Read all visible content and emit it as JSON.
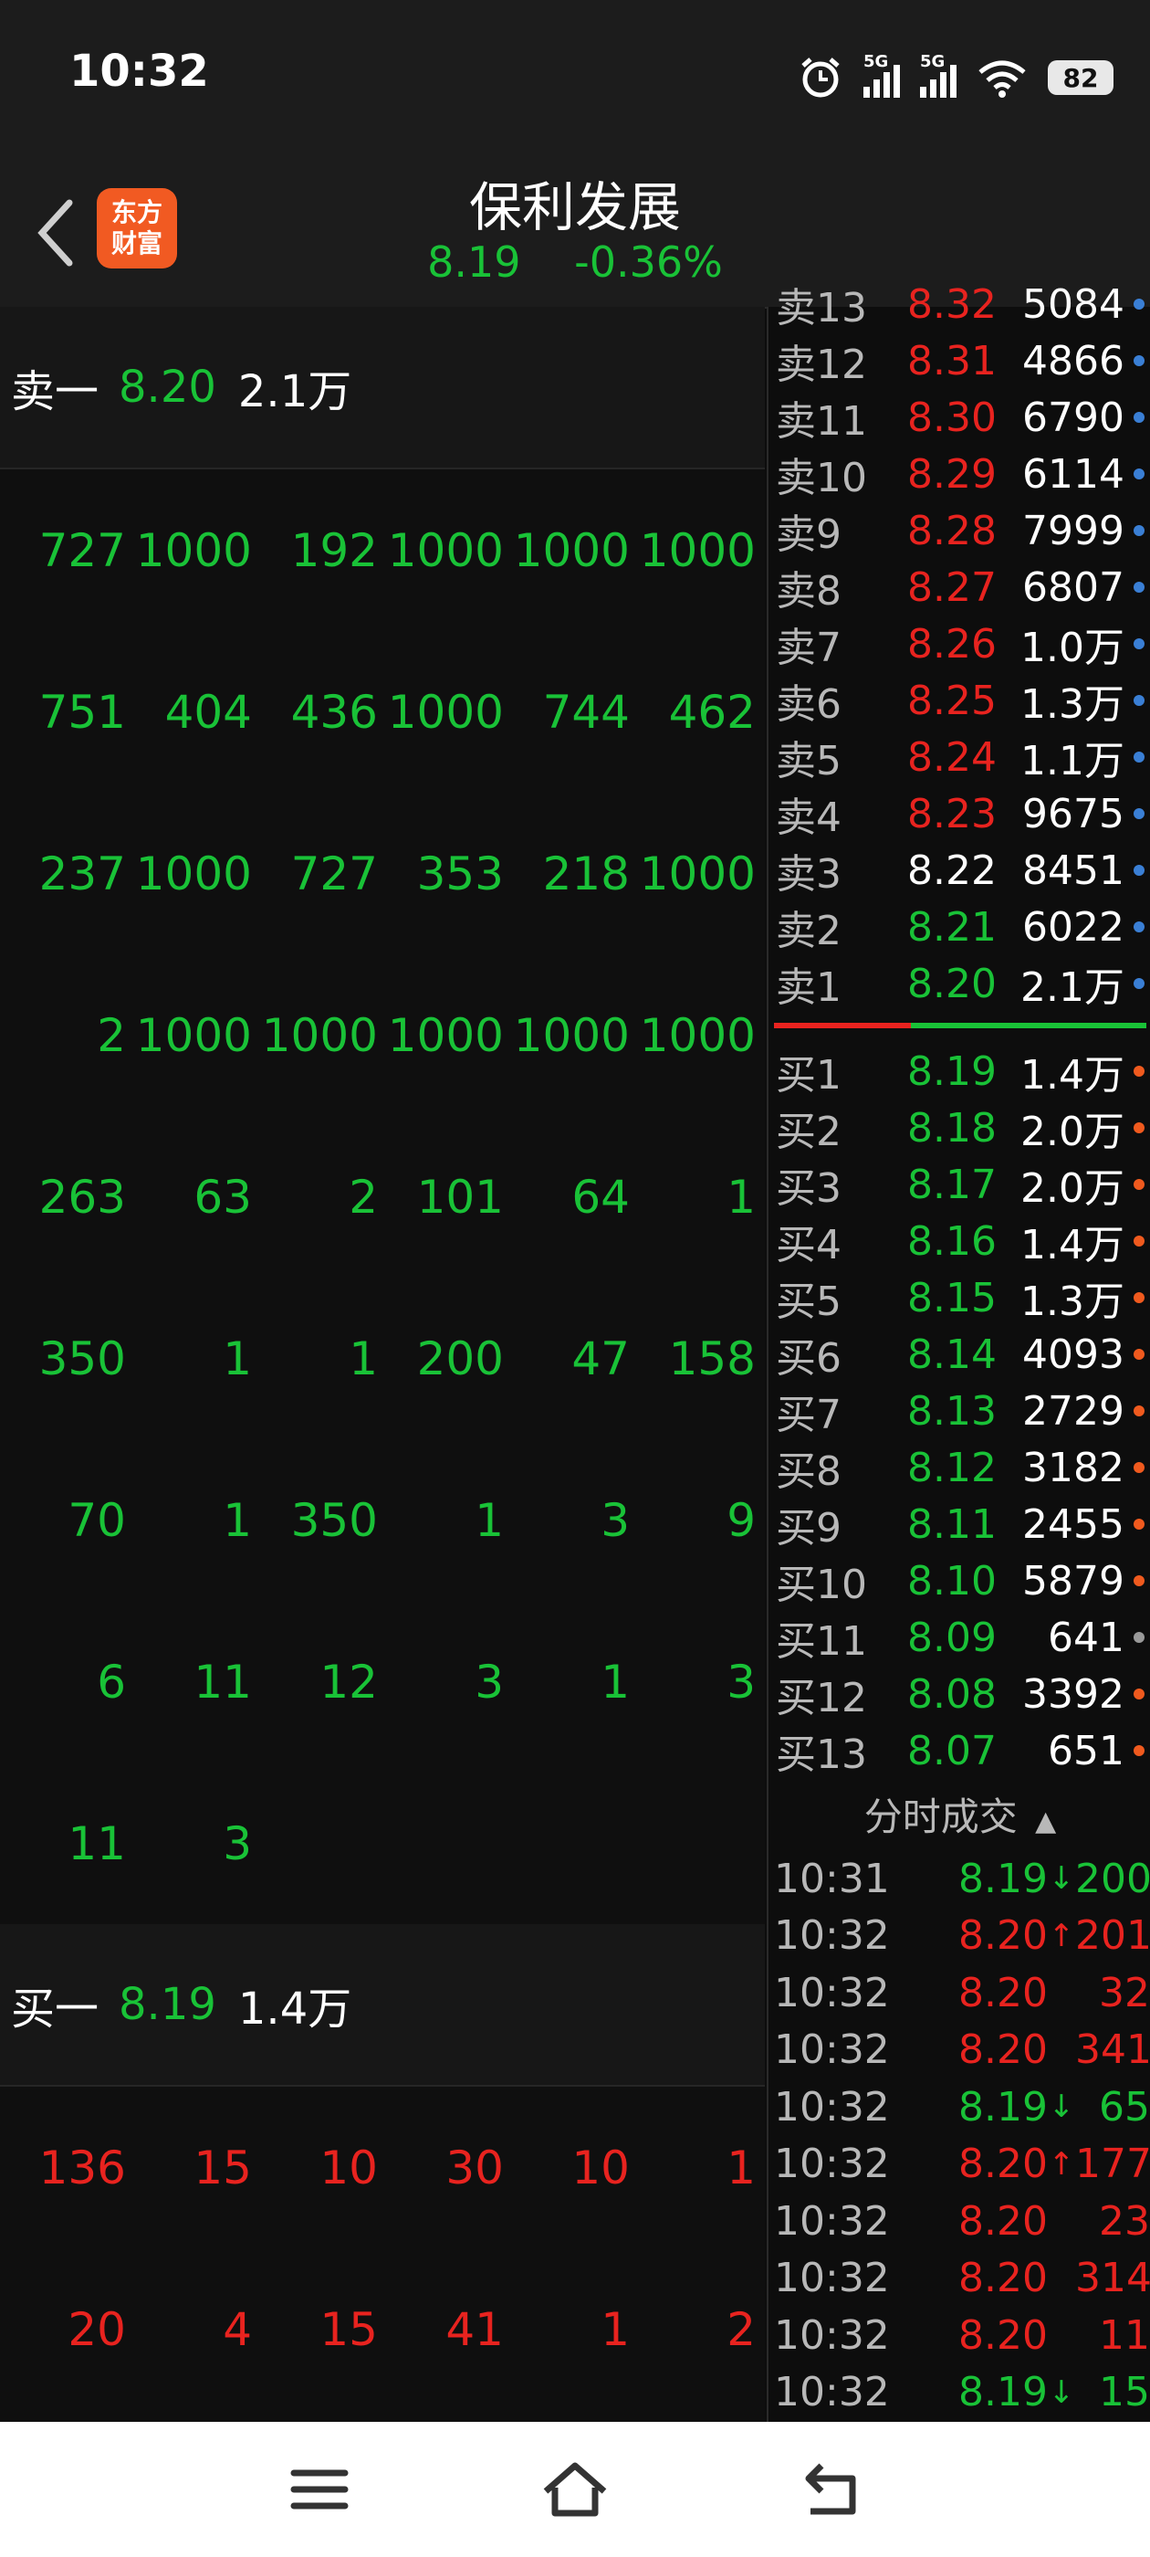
{
  "status_bar": {
    "time": "10:32",
    "network_1": "5G",
    "network_2": "5G",
    "battery": "82"
  },
  "header": {
    "logo_line1": "东方",
    "logo_line2": "财富",
    "title": "保利发展",
    "price": "8.19",
    "change": "-0.36%"
  },
  "left_panel": {
    "sell1": {
      "label": "卖一",
      "price": "8.20",
      "volume": "2.1万"
    },
    "sell_queue": [
      [
        "727",
        "1000",
        "192",
        "1000",
        "1000",
        "1000"
      ],
      [
        "751",
        "404",
        "436",
        "1000",
        "744",
        "462"
      ],
      [
        "237",
        "1000",
        "727",
        "353",
        "218",
        "1000"
      ],
      [
        "2",
        "1000",
        "1000",
        "1000",
        "1000",
        "1000"
      ],
      [
        "263",
        "63",
        "2",
        "101",
        "64",
        "1"
      ],
      [
        "350",
        "1",
        "1",
        "200",
        "47",
        "158"
      ],
      [
        "70",
        "1",
        "350",
        "1",
        "3",
        "9"
      ],
      [
        "6",
        "11",
        "12",
        "3",
        "1",
        "3"
      ],
      [
        "11",
        "3",
        "",
        "",
        "",
        ""
      ]
    ],
    "buy1": {
      "label": "买一",
      "price": "8.19",
      "volume": "1.4万"
    },
    "buy_queue": [
      [
        "136",
        "15",
        "10",
        "30",
        "10",
        "1"
      ],
      [
        "20",
        "4",
        "15",
        "41",
        "1",
        "2"
      ]
    ]
  },
  "order_book": {
    "partial_top": {
      "label": "卖13",
      "price": "8.32",
      "volume": "5084"
    },
    "asks": [
      {
        "label": "卖12",
        "price": "8.31",
        "volume": "4866",
        "color": "red",
        "dot": "blue"
      },
      {
        "label": "卖11",
        "price": "8.30",
        "volume": "6790",
        "color": "red",
        "dot": "blue"
      },
      {
        "label": "卖10",
        "price": "8.29",
        "volume": "6114",
        "color": "red",
        "dot": "blue"
      },
      {
        "label": "卖9",
        "price": "8.28",
        "volume": "7999",
        "color": "red",
        "dot": "blue"
      },
      {
        "label": "卖8",
        "price": "8.27",
        "volume": "6807",
        "color": "red",
        "dot": "blue"
      },
      {
        "label": "卖7",
        "price": "8.26",
        "volume": "1.0万",
        "color": "red",
        "dot": "blue"
      },
      {
        "label": "卖6",
        "price": "8.25",
        "volume": "1.3万",
        "color": "red",
        "dot": "blue"
      },
      {
        "label": "卖5",
        "price": "8.24",
        "volume": "1.1万",
        "color": "red",
        "dot": "blue"
      },
      {
        "label": "卖4",
        "price": "8.23",
        "volume": "9675",
        "color": "red",
        "dot": "blue"
      },
      {
        "label": "卖3",
        "price": "8.22",
        "volume": "8451",
        "color": "white",
        "dot": "blue"
      },
      {
        "label": "卖2",
        "price": "8.21",
        "volume": "6022",
        "color": "green",
        "dot": "blue"
      },
      {
        "label": "卖1",
        "price": "8.20",
        "volume": "2.1万",
        "color": "green",
        "dot": "blue"
      }
    ],
    "bids": [
      {
        "label": "买1",
        "price": "8.19",
        "volume": "1.4万",
        "color": "green",
        "dot": "orange"
      },
      {
        "label": "买2",
        "price": "8.18",
        "volume": "2.0万",
        "color": "green",
        "dot": "orange"
      },
      {
        "label": "买3",
        "price": "8.17",
        "volume": "2.0万",
        "color": "green",
        "dot": "orange"
      },
      {
        "label": "买4",
        "price": "8.16",
        "volume": "1.4万",
        "color": "green",
        "dot": "orange"
      },
      {
        "label": "买5",
        "price": "8.15",
        "volume": "1.3万",
        "color": "green",
        "dot": "orange"
      },
      {
        "label": "买6",
        "price": "8.14",
        "volume": "4093",
        "color": "green",
        "dot": "orange"
      },
      {
        "label": "买7",
        "price": "8.13",
        "volume": "2729",
        "color": "green",
        "dot": "orange"
      },
      {
        "label": "买8",
        "price": "8.12",
        "volume": "3182",
        "color": "green",
        "dot": "orange"
      },
      {
        "label": "买9",
        "price": "8.11",
        "volume": "2455",
        "color": "green",
        "dot": "orange"
      },
      {
        "label": "买10",
        "price": "8.10",
        "volume": "5879",
        "color": "green",
        "dot": "orange"
      },
      {
        "label": "买11",
        "price": "8.09",
        "volume": "641",
        "color": "green",
        "dot": "gray"
      },
      {
        "label": "买12",
        "price": "8.08",
        "volume": "3392",
        "color": "green",
        "dot": "orange"
      },
      {
        "label": "买13",
        "price": "8.07",
        "volume": "651",
        "color": "green",
        "dot": "orange"
      }
    ]
  },
  "ticks": {
    "title": "分时成交",
    "rows": [
      {
        "time": "10:31",
        "price": "8.19",
        "arrow": "↓",
        "volume": "200",
        "color": "green"
      },
      {
        "time": "10:32",
        "price": "8.20",
        "arrow": "↑",
        "volume": "201",
        "color": "red"
      },
      {
        "time": "10:32",
        "price": "8.20",
        "arrow": "",
        "volume": "32",
        "color": "red"
      },
      {
        "time": "10:32",
        "price": "8.20",
        "arrow": "",
        "volume": "341",
        "color": "red"
      },
      {
        "time": "10:32",
        "price": "8.19",
        "arrow": "↓",
        "volume": "65",
        "color": "green"
      },
      {
        "time": "10:32",
        "price": "8.20",
        "arrow": "↑",
        "volume": "177",
        "color": "red"
      },
      {
        "time": "10:32",
        "price": "8.20",
        "arrow": "",
        "volume": "23",
        "color": "red"
      },
      {
        "time": "10:32",
        "price": "8.20",
        "arrow": "",
        "volume": "314",
        "color": "red"
      },
      {
        "time": "10:32",
        "price": "8.20",
        "arrow": "",
        "volume": "11",
        "color": "red"
      },
      {
        "time": "10:32",
        "price": "8.19",
        "arrow": "↓",
        "volume": "15",
        "color": "green"
      }
    ]
  },
  "colors": {
    "green": "#19c237",
    "red": "#e8231f",
    "white": "#ffffff",
    "blue": "#3a7fd5",
    "orange": "#f05a1e",
    "gray": "#999999"
  },
  "nav": {
    "icons": [
      "menu-icon",
      "home-icon",
      "back-icon"
    ]
  }
}
